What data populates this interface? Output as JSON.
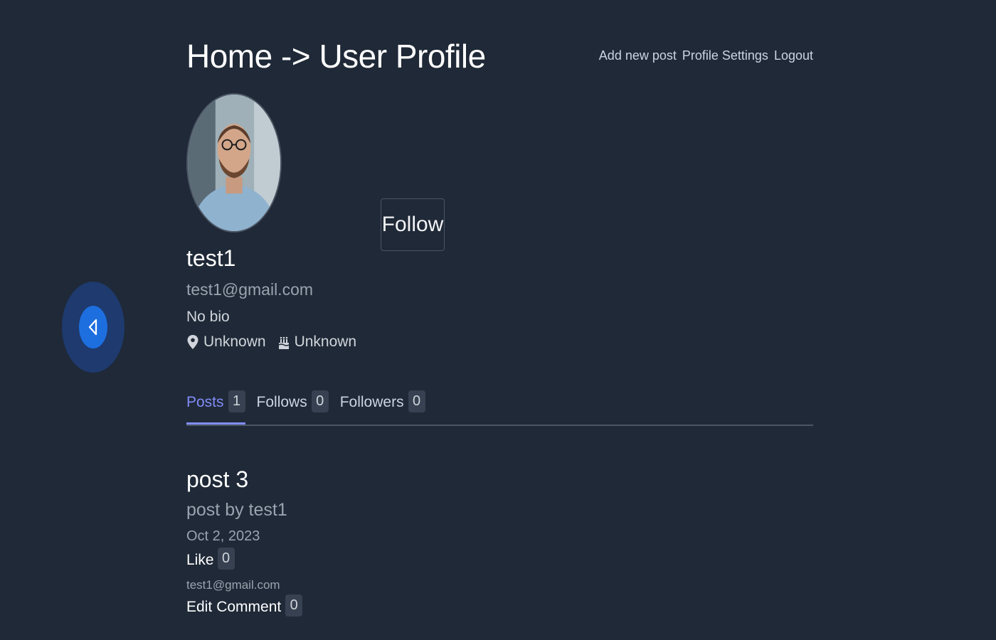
{
  "header": {
    "title": "Home -> User Profile",
    "nav": {
      "add_post": "Add new post",
      "profile_settings": "Profile Settings",
      "logout": "Logout"
    }
  },
  "profile": {
    "username": "test1",
    "email": "test1@gmail.com",
    "bio": "No bio",
    "location": "Unknown",
    "birthday": "Unknown",
    "follow_label": "Follow"
  },
  "tabs": [
    {
      "label": "Posts",
      "count": "1",
      "active": true
    },
    {
      "label": "Follows",
      "count": "0",
      "active": false
    },
    {
      "label": "Followers",
      "count": "0",
      "active": false
    }
  ],
  "post": {
    "title": "post 3",
    "body": "post by test1",
    "date": "Oct 2, 2023",
    "like_label": "Like",
    "like_count": "0",
    "author_email": "test1@gmail.com",
    "edit_label": "Edit",
    "comment_label": "Comment",
    "comment_count": "0"
  },
  "icons": {
    "back": "chevron-left-icon",
    "location": "map-pin-icon",
    "birthday": "cake-icon"
  },
  "colors": {
    "background": "#1f2937",
    "accent": "#818cf8",
    "back_button": "#1d6fe0"
  }
}
